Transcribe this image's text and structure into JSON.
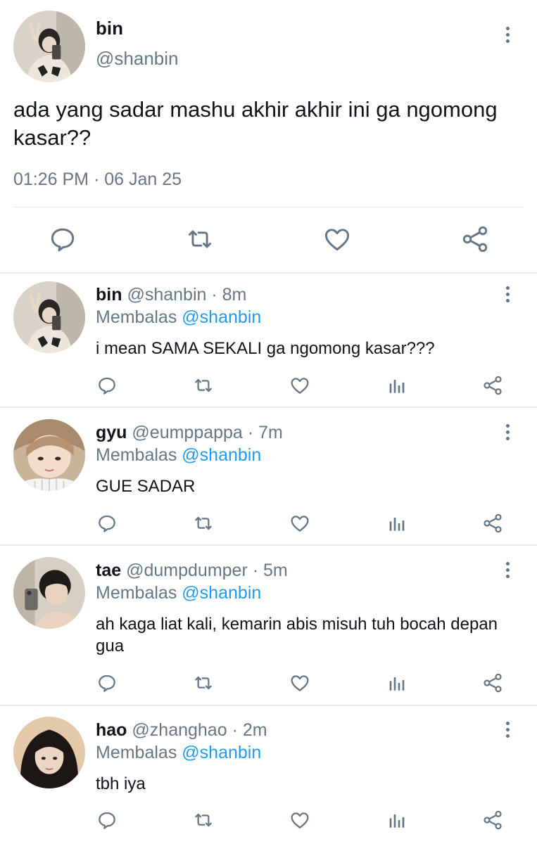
{
  "main_tweet": {
    "name": "bin",
    "handle": "@shanbin",
    "text": "ada yang sadar mashu akhir akhir ini ga ngomong kasar??",
    "timestamp": "01:26 PM · 06 Jan 25",
    "actions": [
      "comment-icon",
      "retweet-icon",
      "heart-icon",
      "share-icon"
    ]
  },
  "replies": [
    {
      "name": "bin",
      "handle": "@shanbin",
      "dot": "·",
      "time": "8m",
      "replying_prefix": "Membalas",
      "replying_to": "@shanbin",
      "text": "i mean SAMA SEKALI ga ngomong kasar???"
    },
    {
      "name": "gyu",
      "handle": "@eumppappa",
      "dot": "·",
      "time": "7m",
      "replying_prefix": "Membalas",
      "replying_to": "@shanbin",
      "text": "GUE SADAR"
    },
    {
      "name": "tae",
      "handle": "@dumpdumper",
      "dot": "·",
      "time": "5m",
      "replying_prefix": "Membalas",
      "replying_to": "@shanbin",
      "text": "ah kaga liat kali, kemarin abis misuh tuh bocah depan gua"
    },
    {
      "name": "hao",
      "handle": "@zhanghao",
      "dot": "·",
      "time": "2m",
      "replying_prefix": "Membalas",
      "replying_to": "@shanbin",
      "text": "tbh iya"
    }
  ],
  "reply_actions": [
    "comment-icon",
    "retweet-icon",
    "heart-icon",
    "views-icon",
    "share-icon"
  ],
  "colors": {
    "text": "#0f1419",
    "muted": "#657786",
    "mention": "#1d9bf0",
    "divider": "#e6ecf0"
  }
}
